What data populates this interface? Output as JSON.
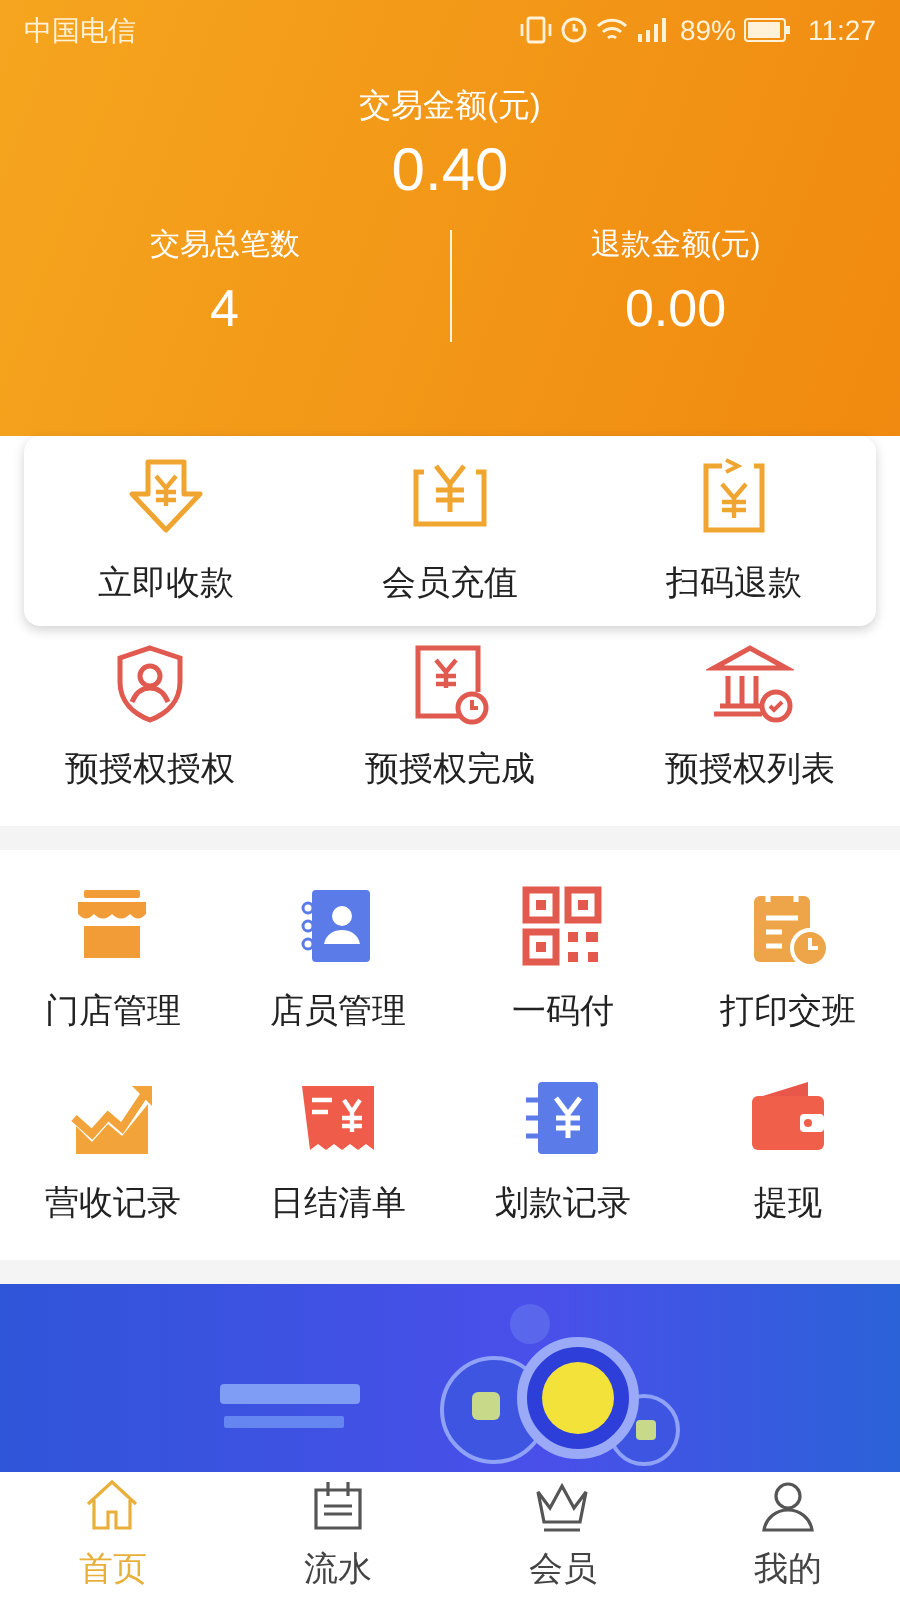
{
  "status_bar": {
    "carrier": "中国电信",
    "battery": "89%",
    "time": "11:27"
  },
  "summary": {
    "amount_label": "交易金额(元)",
    "amount": "0.40",
    "count_label": "交易总笔数",
    "count": "4",
    "refund_label": "退款金额(元)",
    "refund": "0.00"
  },
  "quick_actions": [
    {
      "kind": "receive",
      "label": "立即收款"
    },
    {
      "kind": "recharge",
      "label": "会员充值"
    },
    {
      "kind": "refund",
      "label": "扫码退款"
    }
  ],
  "preauth_actions": [
    {
      "kind": "shield",
      "label": "预授权授权"
    },
    {
      "kind": "complete",
      "label": "预授权完成"
    },
    {
      "kind": "bank",
      "label": "预授权列表"
    }
  ],
  "grid": [
    {
      "kind": "store",
      "label": "门店管理"
    },
    {
      "kind": "contacts",
      "label": "店员管理"
    },
    {
      "kind": "qr",
      "label": "一码付"
    },
    {
      "kind": "calendar",
      "label": "打印交班"
    },
    {
      "kind": "trend",
      "label": "营收记录"
    },
    {
      "kind": "receipt",
      "label": "日结清单"
    },
    {
      "kind": "transfer",
      "label": "划款记录"
    },
    {
      "kind": "wallet",
      "label": "提现"
    }
  ],
  "tabs": [
    {
      "kind": "home",
      "label": "首页",
      "selected": true
    },
    {
      "kind": "flow",
      "label": "流水",
      "selected": false
    },
    {
      "kind": "member",
      "label": "会员",
      "selected": false
    },
    {
      "kind": "profile",
      "label": "我的",
      "selected": false
    }
  ]
}
